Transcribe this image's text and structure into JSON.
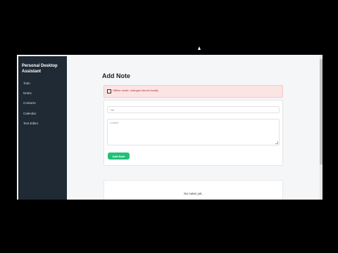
{
  "sidebar": {
    "title": "Personal Desktop Assistant",
    "items": [
      {
        "label": "Todo"
      },
      {
        "label": "Notes"
      },
      {
        "label": "Contacts"
      },
      {
        "label": "Calendar"
      },
      {
        "label": "Text Editor"
      }
    ]
  },
  "main": {
    "heading": "Add Note",
    "alert": "Offline mode: changes stored locally.",
    "form": {
      "title_placeholder": "Title",
      "content_placeholder": "Content",
      "submit_label": "Add Note"
    },
    "list": {
      "empty_text": "No notes yet."
    }
  },
  "colors": {
    "sidebar_bg": "#1f2a35",
    "accent": "#21c178",
    "alert_bg": "#fbe4e4"
  }
}
